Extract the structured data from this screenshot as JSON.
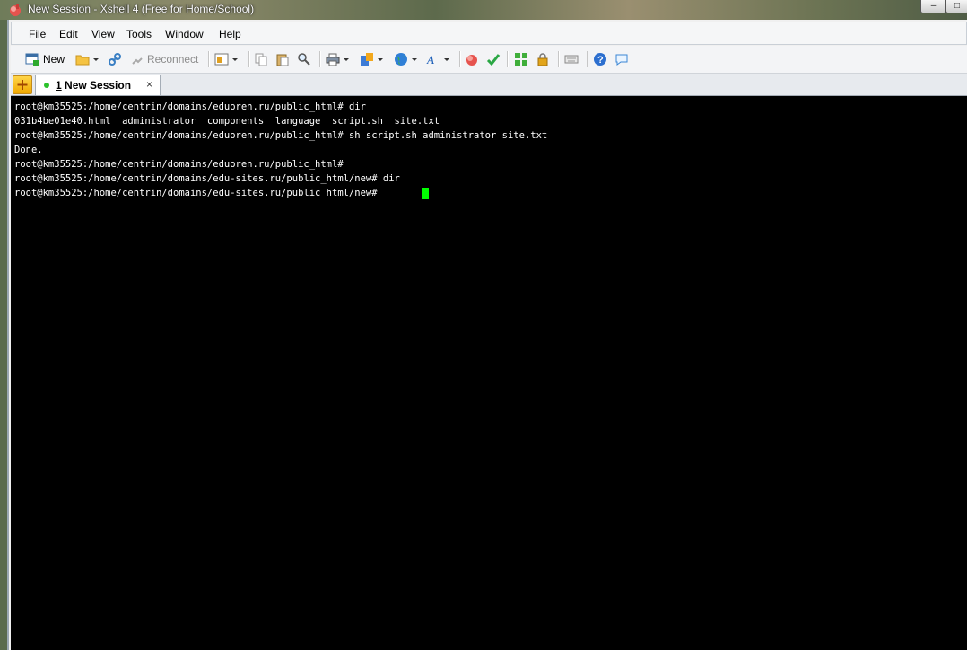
{
  "window": {
    "title": "New Session - Xshell 4 (Free for Home/School)",
    "minimize_glyph": "–",
    "maximize_glyph": "□"
  },
  "menu": [
    "File",
    "Edit",
    "View",
    "Tools",
    "Window",
    "Help"
  ],
  "toolbar": {
    "new_label": "New",
    "reconnect_label": "Reconnect"
  },
  "tabs": {
    "active": {
      "number": "1",
      "name": " New Session",
      "close_glyph": "×"
    }
  },
  "terminal": {
    "lines": [
      "root@km35525:/home/centrin/domains/eduoren.ru/public_html# dir",
      "031b4be01e40.html  administrator  components  language  script.sh  site.txt",
      "root@km35525:/home/centrin/domains/eduoren.ru/public_html# sh script.sh administrator site.txt",
      "Done.",
      "root@km35525:/home/centrin/domains/eduoren.ru/public_html#",
      "root@km35525:/home/centrin/domains/edu-sites.ru/public_html/new# dir",
      "root@km35525:/home/centrin/domains/edu-sites.ru/public_html/new# "
    ],
    "cursor_color": "#00ff00"
  }
}
